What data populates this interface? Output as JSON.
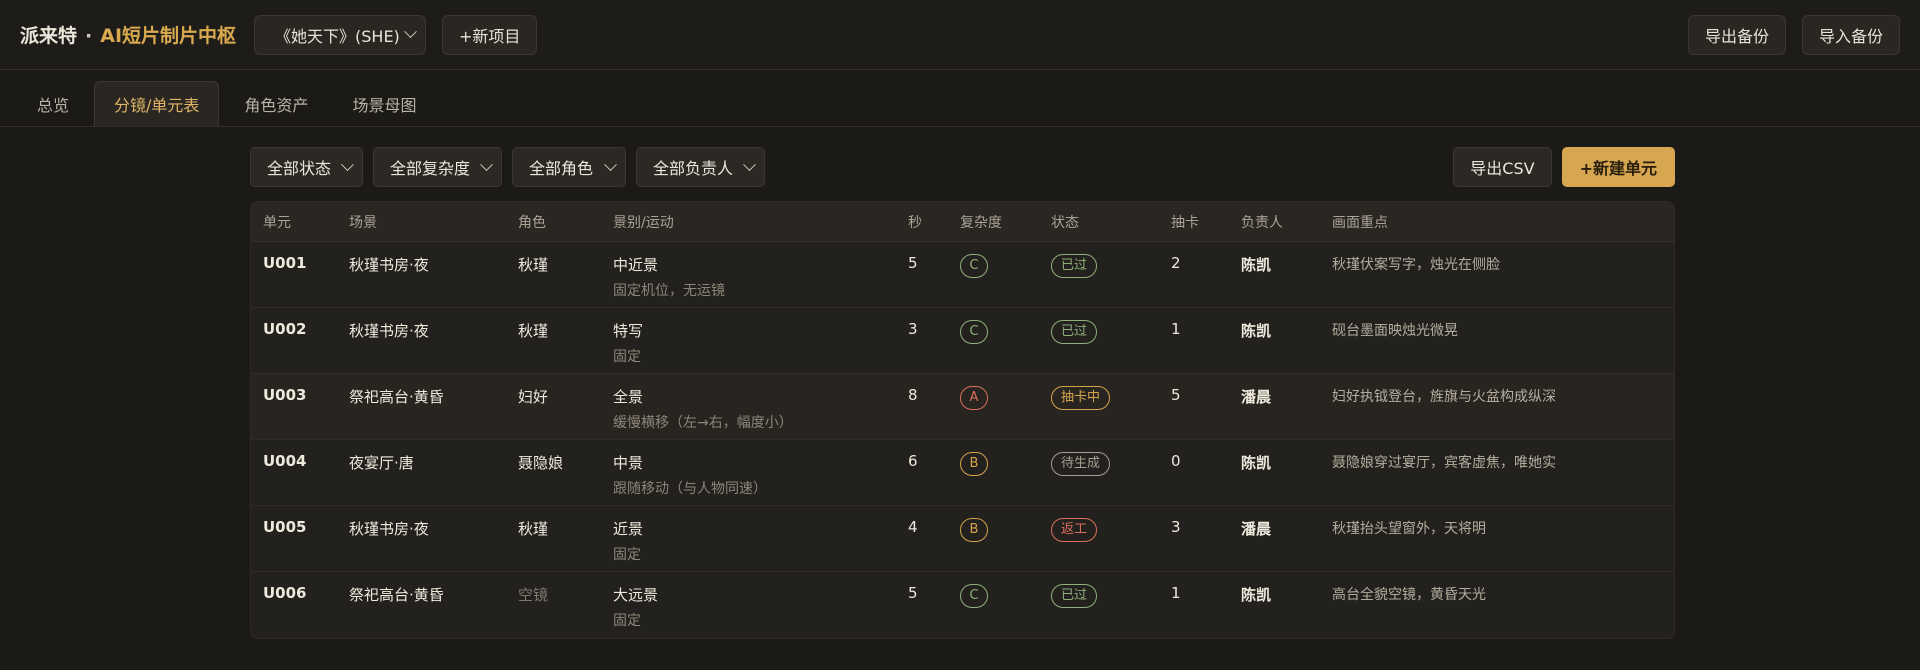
{
  "header": {
    "brand_name": "派来特",
    "brand_dot": "·",
    "brand_subtitle": "AI短片制片中枢",
    "project_select": "《她天下》(SHE)",
    "new_project": "+新项目",
    "export_backup": "导出备份",
    "import_backup": "导入备份"
  },
  "tabs": [
    {
      "label": "总览",
      "active": false
    },
    {
      "label": "分镜/单元表",
      "active": true
    },
    {
      "label": "角色资产",
      "active": false
    },
    {
      "label": "场景母图",
      "active": false
    }
  ],
  "filters": {
    "status": "全部状态",
    "complexity": "全部复杂度",
    "role": "全部角色",
    "owner": "全部负责人",
    "export_csv": "导出CSV",
    "new_unit": "+新建单元"
  },
  "table": {
    "headers": [
      "单元",
      "场景",
      "角色",
      "景别/运动",
      "秒",
      "复杂度",
      "状态",
      "抽卡",
      "负责人",
      "画面重点"
    ],
    "rows": [
      {
        "id": "U001",
        "scene": "秋瑾书房·夜",
        "role": "秋瑾",
        "role_muted": false,
        "shot": "中近景",
        "move": "固定机位，无运镜",
        "sec": "5",
        "complexity": "C",
        "status": "已过",
        "cards": "2",
        "owner": "陈凯",
        "note": "秋瑾伏案写字，烛光在侧脸"
      },
      {
        "id": "U002",
        "scene": "秋瑾书房·夜",
        "role": "秋瑾",
        "role_muted": false,
        "shot": "特写",
        "move": "固定",
        "sec": "3",
        "complexity": "C",
        "status": "已过",
        "cards": "1",
        "owner": "陈凯",
        "note": "砚台墨面映烛光微晃"
      },
      {
        "id": "U003",
        "scene": "祭祀高台·黄昏",
        "role": "妇好",
        "role_muted": false,
        "shot": "全景",
        "move": "缓慢横移（左→右，幅度小）",
        "sec": "8",
        "complexity": "A",
        "status": "抽卡中",
        "cards": "5",
        "owner": "潘晨",
        "note": "妇好执钺登台，旌旗与火盆构成纵深"
      },
      {
        "id": "U004",
        "scene": "夜宴厅·唐",
        "role": "聂隐娘",
        "role_muted": false,
        "shot": "中景",
        "move": "跟随移动（与人物同速）",
        "sec": "6",
        "complexity": "B",
        "status": "待生成",
        "cards": "0",
        "owner": "陈凯",
        "note": "聂隐娘穿过宴厅，宾客虚焦，唯她实"
      },
      {
        "id": "U005",
        "scene": "秋瑾书房·夜",
        "role": "秋瑾",
        "role_muted": false,
        "shot": "近景",
        "move": "固定",
        "sec": "4",
        "complexity": "B",
        "status": "返工",
        "cards": "3",
        "owner": "潘晨",
        "note": "秋瑾抬头望窗外，天将明"
      },
      {
        "id": "U006",
        "scene": "祭祀高台·黄昏",
        "role": "空镜",
        "role_muted": true,
        "shot": "大远景",
        "move": "固定",
        "sec": "5",
        "complexity": "C",
        "status": "已过",
        "cards": "1",
        "owner": "陈凯",
        "note": "高台全貌空镜，黄昏天光"
      }
    ]
  },
  "colors": {
    "accent": "#d6a650",
    "complexity": {
      "A": "#d9705f",
      "B": "#d4a34c",
      "C": "#8fb07a"
    },
    "status": {
      "已过": "#8fb07a",
      "抽卡中": "#d4a34c",
      "待生成": "#a59e91",
      "返工": "#d9705f"
    }
  }
}
